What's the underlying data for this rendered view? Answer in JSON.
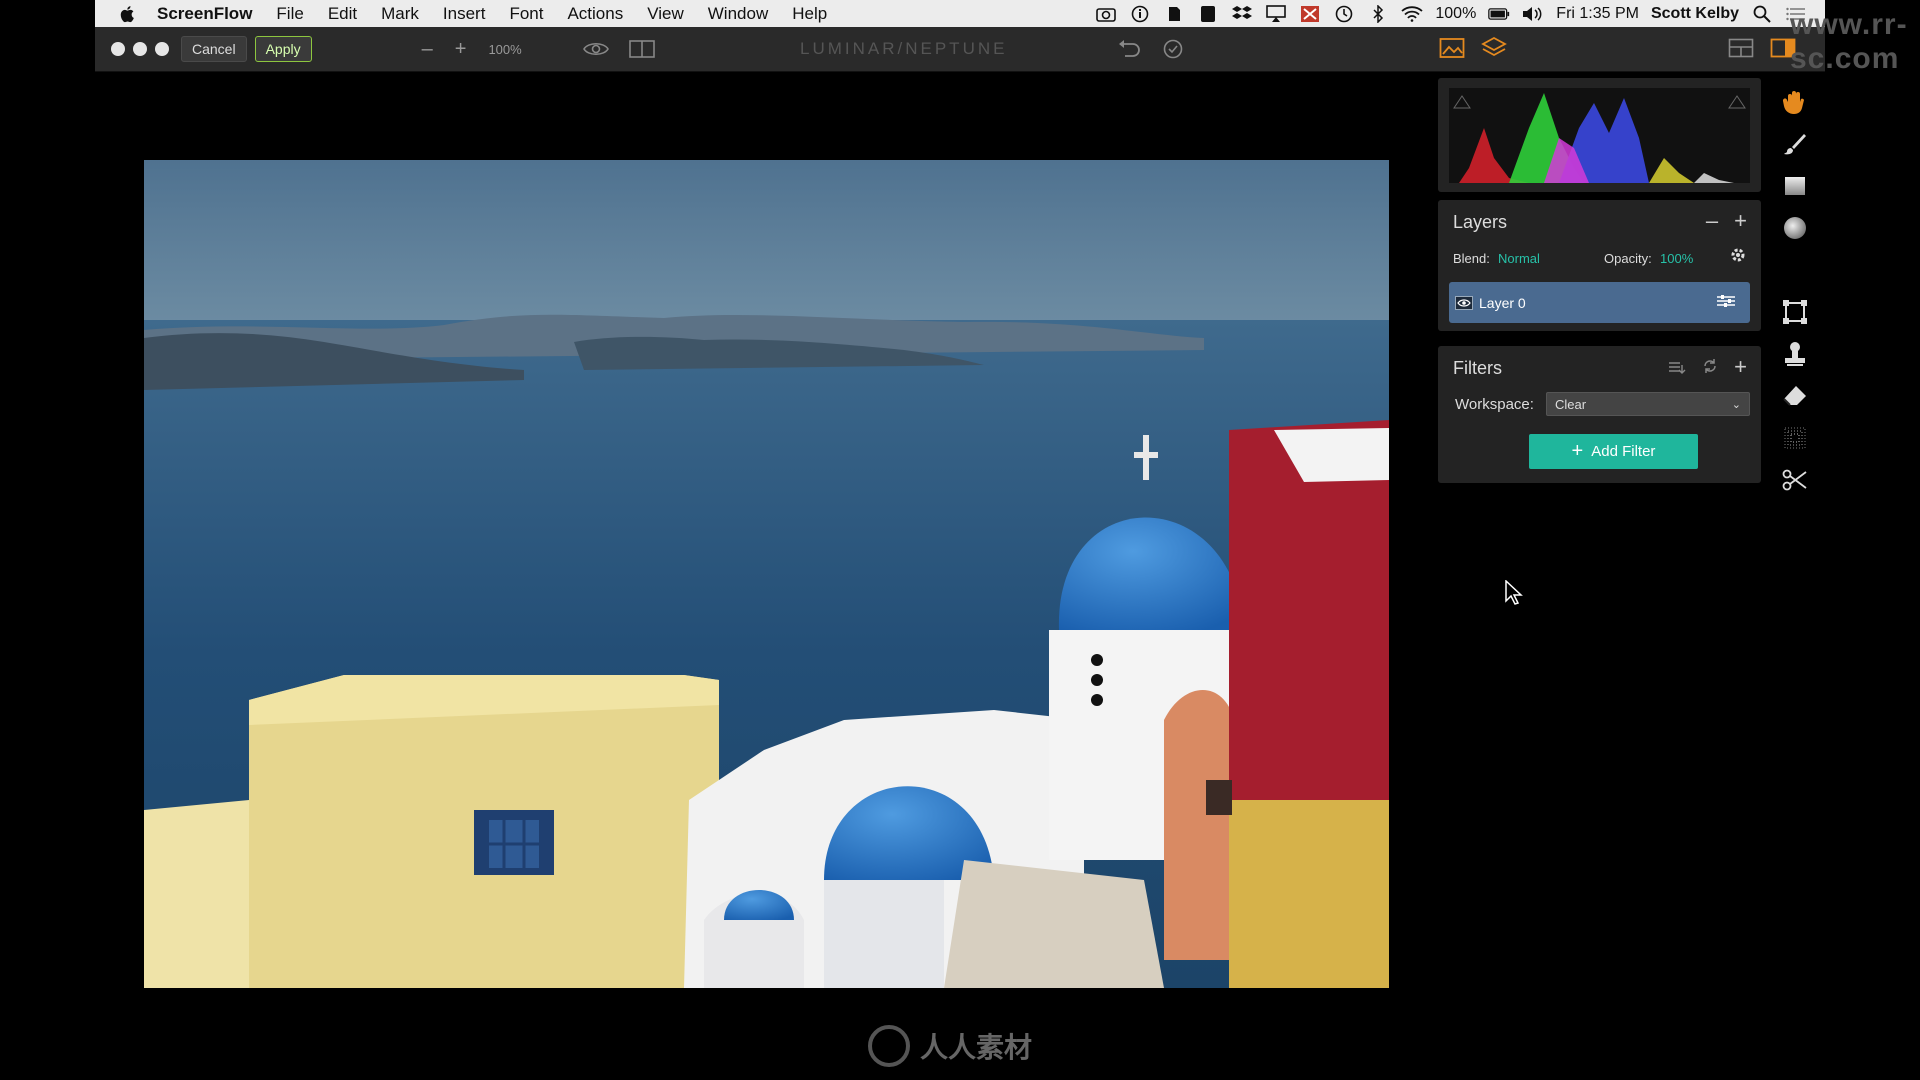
{
  "menubar": {
    "app_name": "ScreenFlow",
    "items": [
      "File",
      "Edit",
      "Mark",
      "Insert",
      "Font",
      "Actions",
      "View",
      "Window",
      "Help"
    ],
    "battery": "100%",
    "clock": "Fri 1:35 PM",
    "user": "Scott Kelby"
  },
  "toolbar": {
    "cancel_label": "Cancel",
    "apply_label": "Apply",
    "zoom_label": "100%",
    "app_title": "LUMINAR/NEPTUNE"
  },
  "layers": {
    "title": "Layers",
    "blend_label": "Blend:",
    "blend_value": "Normal",
    "opacity_label": "Opacity:",
    "opacity_value": "100%",
    "layer_name": "Layer 0"
  },
  "filters": {
    "title": "Filters",
    "workspace_label": "Workspace:",
    "workspace_value": "Clear",
    "add_filter_label": "Add Filter"
  },
  "watermark": {
    "logo_text": "人人素材",
    "corner_text": "www.rr-sc.com"
  },
  "colors": {
    "accent": "#27c1a8",
    "layer_selected": "#4a6a90",
    "apply_border": "#8dc63f"
  },
  "icons": {
    "toolrail": [
      "hand-icon",
      "brush-icon",
      "gradient-icon",
      "radial-icon",
      "crop-icon",
      "stamp-icon",
      "eraser-icon",
      "noise-icon",
      "transform-icon"
    ]
  }
}
